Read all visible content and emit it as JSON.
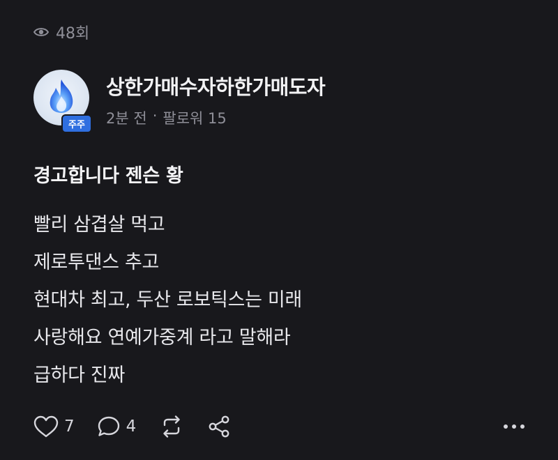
{
  "post": {
    "views": "48회",
    "author": {
      "name": "상한가매수자하한가매도자",
      "badge": "주주",
      "time": "2분 전",
      "separator": "·",
      "followers": "팔로워 15"
    },
    "title": "경고합니다 젠슨 황",
    "body": [
      "빨리 삼겹살 먹고",
      "제로투댄스 추고",
      "현대차 최고, 두산 로보틱스는 미래",
      "사랑해요 연예가중계 라고 말해라",
      "급하다 진짜"
    ]
  },
  "actions": {
    "likes": "7",
    "comments": "4"
  },
  "icons": {
    "views": "eye-icon",
    "avatar": "blue-flame-icon",
    "like": "heart-icon",
    "comment": "comment-bubble-icon",
    "repost": "repost-icon",
    "share": "share-icon",
    "more": "more-dots-icon"
  },
  "colors": {
    "background": "#18181c",
    "muted_text": "#8f8f98",
    "badge": "#2f6fe0",
    "flame": "#3b82f6"
  }
}
